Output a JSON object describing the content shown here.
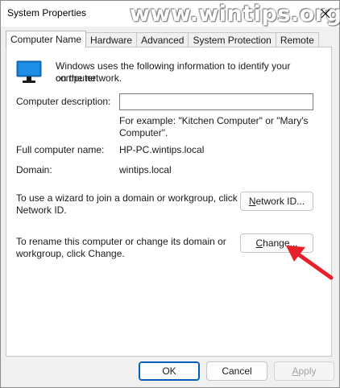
{
  "window": {
    "title": "System Properties",
    "watermark": "www.wintips.org"
  },
  "tabs": [
    {
      "label": "Computer Name",
      "active": true
    },
    {
      "label": "Hardware",
      "active": false
    },
    {
      "label": "Advanced",
      "active": false
    },
    {
      "label": "System Protection",
      "active": false
    },
    {
      "label": "Remote",
      "active": false
    }
  ],
  "panel": {
    "intro_line1": "Windows uses the following information to identify your computer",
    "intro_line2": "on the network.",
    "description_label": "Computer description:",
    "description_value": "",
    "example_line1": "For example: \"Kitchen Computer\" or \"Mary's",
    "example_line2": "Computer\".",
    "full_name_label": "Full computer name:",
    "full_name_value": "HP-PC.wintips.local",
    "domain_label": "Domain:",
    "domain_value": "wintips.local",
    "wizard_line1": "To use a wizard to join a domain or workgroup, click",
    "wizard_line2": "Network ID.",
    "network_id_first": "N",
    "network_id_rest": "etwork ID...",
    "rename_line1": "To rename this computer or change its domain or",
    "rename_line2": "workgroup, click Change.",
    "change_first": "C",
    "change_rest": "hange..."
  },
  "footer": {
    "ok_label": "OK",
    "cancel_label": "Cancel",
    "apply_first": "A",
    "apply_rest": "pply"
  },
  "colors": {
    "accent": "#005fb8",
    "arrow": "#e8202a",
    "monitor": "#1478c8"
  },
  "icons": {
    "close": "close-icon",
    "monitor": "computer-monitor-icon",
    "arrow": "red-pointer-arrow-icon"
  }
}
